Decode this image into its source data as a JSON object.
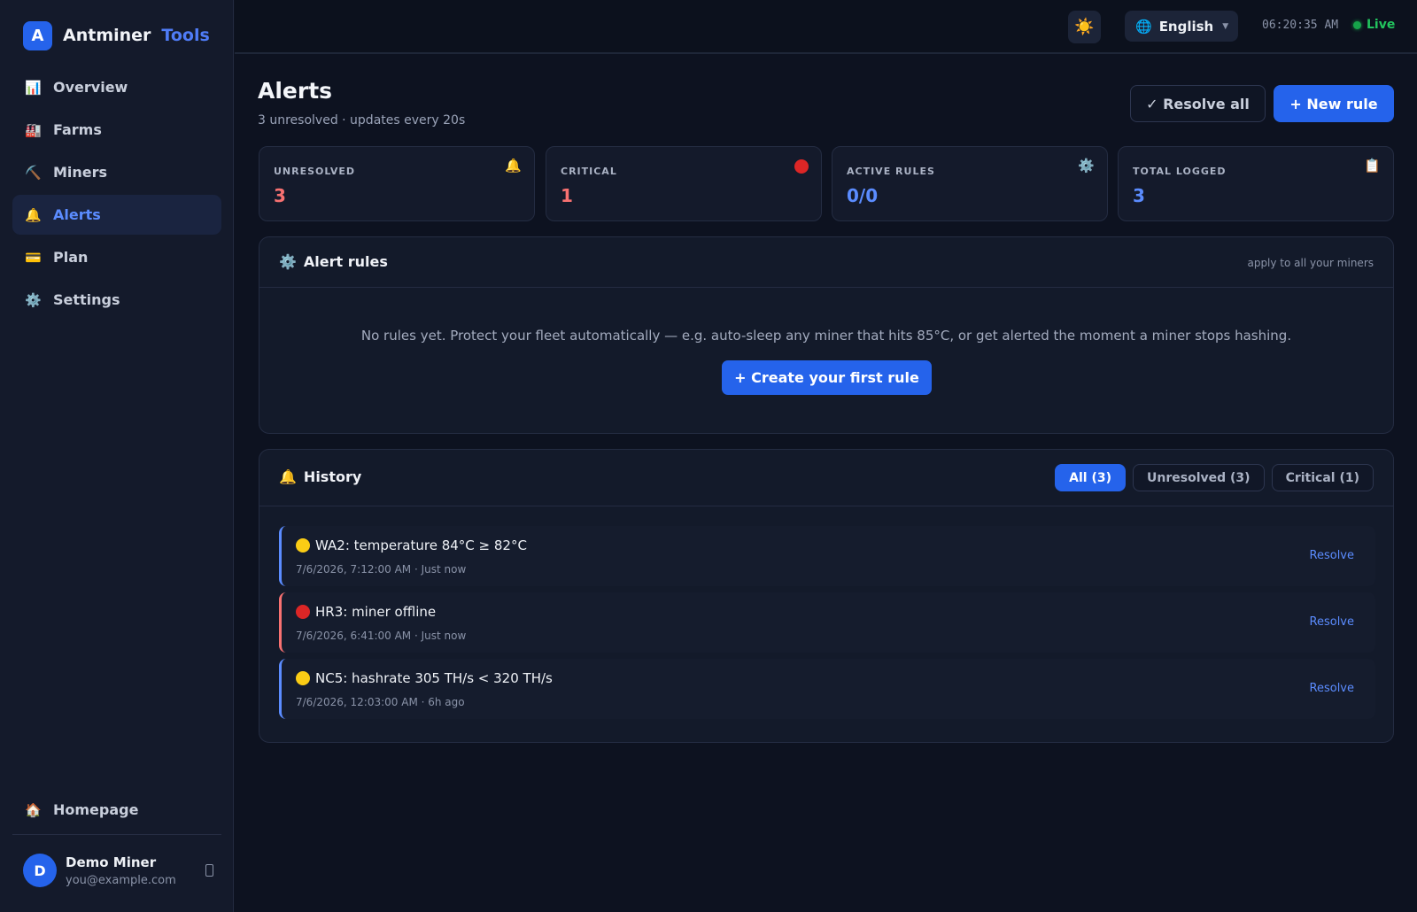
{
  "brand": {
    "logo_letter": "A",
    "name": "Antminer",
    "accent": "Tools"
  },
  "nav": {
    "items": [
      {
        "icon": "chart-icon",
        "glyph": "📊",
        "label": "Overview"
      },
      {
        "icon": "factory-icon",
        "glyph": "🏭",
        "label": "Farms"
      },
      {
        "icon": "pickaxe-icon",
        "glyph": "⛏️",
        "label": "Miners"
      },
      {
        "icon": "bell-icon",
        "glyph": "🔔",
        "label": "Alerts",
        "active": true
      },
      {
        "icon": "card-icon",
        "glyph": "💳",
        "label": "Plan"
      },
      {
        "icon": "gear-icon",
        "glyph": "⚙️",
        "label": "Settings"
      }
    ],
    "homepage": {
      "icon": "house-icon",
      "glyph": "🏠",
      "label": "Homepage"
    }
  },
  "user": {
    "initial": "D",
    "name": "Demo Miner",
    "email": "you@example.com"
  },
  "topbar": {
    "theme_glyph": "☀️",
    "language": "English",
    "language_glyph": "🌐",
    "clock": "06:20:35 AM",
    "status": "Live"
  },
  "page": {
    "title": "Alerts",
    "subtitle": "3 unresolved · updates every 20s",
    "resolve_all": "✓ Resolve all",
    "new_rule": "+ New rule"
  },
  "stats": [
    {
      "label": "UNRESOLVED",
      "value": "3",
      "color": "#f87171",
      "icon": "bell-icon",
      "glyph": "🔔"
    },
    {
      "label": "CRITICAL",
      "value": "1",
      "color": "#f87171",
      "icon": "red-circle-icon",
      "glyph": ""
    },
    {
      "label": "ACTIVE RULES",
      "value": "0/0",
      "color": "#5b8cff",
      "icon": "gear-icon",
      "glyph": "⚙️"
    },
    {
      "label": "TOTAL LOGGED",
      "value": "3",
      "color": "#5b8cff",
      "icon": "clipboard-icon",
      "glyph": "📋"
    }
  ],
  "rules": {
    "glyph": "⚙️",
    "title": "Alert rules",
    "note": "apply to all your miners",
    "empty": "No rules yet. Protect your fleet automatically — e.g. auto-sleep any miner that hits 85°C, or get alerted the moment a miner stops hashing.",
    "create": "+ Create your first rule"
  },
  "history": {
    "glyph": "🔔",
    "title": "History",
    "filters": [
      "All (3)",
      "Unresolved (3)",
      "Critical (1)"
    ],
    "items": [
      {
        "severity": "warning",
        "title": "WA2: temperature 84°C ≥ 82°C",
        "meta": "7/6/2026, 7:12:00 AM · Just now",
        "action": "Resolve"
      },
      {
        "severity": "critical",
        "title": "HR3: miner offline",
        "meta": "7/6/2026, 6:41:00 AM · Just now",
        "action": "Resolve"
      },
      {
        "severity": "warning",
        "title": "NC5: hashrate 305 TH/s < 320 TH/s",
        "meta": "7/6/2026, 12:03:00 AM · 6h ago",
        "action": "Resolve"
      }
    ]
  },
  "colors": {
    "accent": "#2563eb",
    "link": "#5b8cff",
    "critical": "#dc2626",
    "warning": "#facc15",
    "live": "#22c55e"
  }
}
